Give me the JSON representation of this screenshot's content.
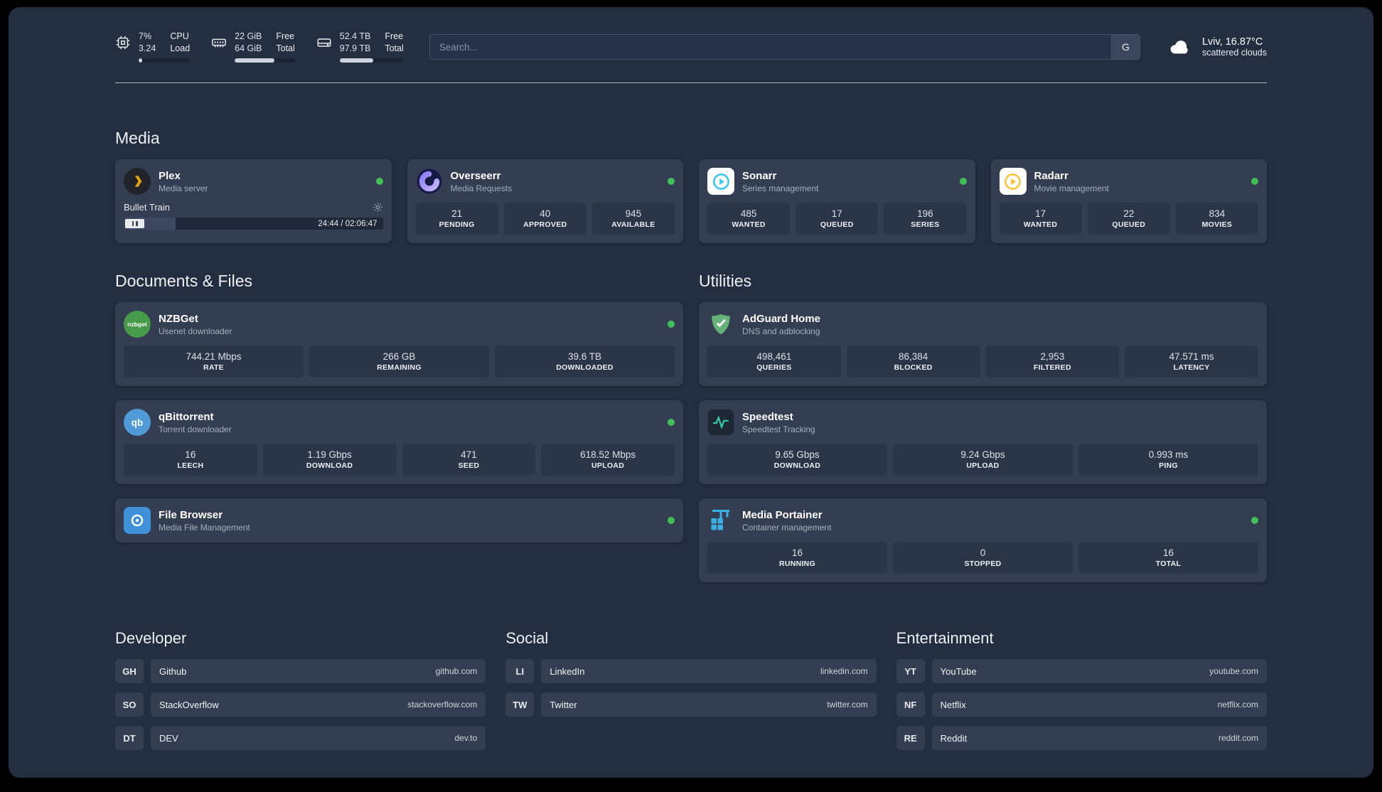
{
  "colors": {
    "status_online": "#40c057",
    "plex": "#e5a00d",
    "overseerr": "#a78bfa",
    "sonarr": "#35c5f4",
    "radarr": "#ffc230",
    "nzbget": "#479a4a",
    "qbittorrent": "#4f9bd8",
    "filebrowser": "#3f8fd9",
    "adguard": "#67b279",
    "speedtest": "#2dd4a8",
    "portainer": "#3bb0e5"
  },
  "topbar": {
    "cpu": {
      "value1": "7%",
      "value2": "3.24",
      "label1": "CPU",
      "label2": "Load",
      "percent": 7
    },
    "ram": {
      "value1": "22 GiB",
      "value2": "64 GiB",
      "label1": "Free",
      "label2": "Total",
      "percent": 66
    },
    "disk": {
      "value1": "52.4 TB",
      "value2": "97.9 TB",
      "label1": "Free",
      "label2": "Total",
      "percent": 53
    },
    "search": {
      "placeholder": "Search...",
      "button_label": "G"
    },
    "weather": {
      "location": "Lviv, 16.87°C",
      "condition": "scattered clouds"
    }
  },
  "sections": {
    "media": "Media",
    "documents": "Documents & Files",
    "utilities": "Utilities",
    "developer": "Developer",
    "social": "Social",
    "entertainment": "Entertainment"
  },
  "apps": {
    "plex": {
      "name": "Plex",
      "desc": "Media server",
      "now_playing": {
        "title": "Bullet Train",
        "time": "24:44 / 02:06:47",
        "progress_percent": 20
      }
    },
    "overseerr": {
      "name": "Overseerr",
      "desc": "Media Requests",
      "stats": [
        {
          "value": "21",
          "label": "PENDING"
        },
        {
          "value": "40",
          "label": "APPROVED"
        },
        {
          "value": "945",
          "label": "AVAILABLE"
        }
      ]
    },
    "sonarr": {
      "name": "Sonarr",
      "desc": "Series management",
      "stats": [
        {
          "value": "485",
          "label": "WANTED"
        },
        {
          "value": "17",
          "label": "QUEUED"
        },
        {
          "value": "196",
          "label": "SERIES"
        }
      ]
    },
    "radarr": {
      "name": "Radarr",
      "desc": "Movie management",
      "stats": [
        {
          "value": "17",
          "label": "WANTED"
        },
        {
          "value": "22",
          "label": "QUEUED"
        },
        {
          "value": "834",
          "label": "MOVIES"
        }
      ]
    },
    "nzbget": {
      "name": "NZBGet",
      "desc": "Usenet downloader",
      "icon_text": "nzbget",
      "stats": [
        {
          "value": "744.21 Mbps",
          "label": "RATE"
        },
        {
          "value": "266 GB",
          "label": "REMAINING"
        },
        {
          "value": "39.6 TB",
          "label": "DOWNLOADED"
        }
      ]
    },
    "qbittorrent": {
      "name": "qBittorrent",
      "desc": "Torrent downloader",
      "icon_text": "qb",
      "stats": [
        {
          "value": "16",
          "label": "LEECH"
        },
        {
          "value": "1.19 Gbps",
          "label": "DOWNLOAD"
        },
        {
          "value": "471",
          "label": "SEED"
        },
        {
          "value": "618.52 Mbps",
          "label": "UPLOAD"
        }
      ]
    },
    "filebrowser": {
      "name": "File Browser",
      "desc": "Media File Management"
    },
    "adguard": {
      "name": "AdGuard Home",
      "desc": "DNS and adblocking",
      "stats": [
        {
          "value": "498,461",
          "label": "QUERIES"
        },
        {
          "value": "86,384",
          "label": "BLOCKED"
        },
        {
          "value": "2,953",
          "label": "FILTERED"
        },
        {
          "value": "47.571 ms",
          "label": "LATENCY"
        }
      ]
    },
    "speedtest": {
      "name": "Speedtest",
      "desc": "Speedtest Tracking",
      "stats": [
        {
          "value": "9.65 Gbps",
          "label": "DOWNLOAD"
        },
        {
          "value": "9.24 Gbps",
          "label": "UPLOAD"
        },
        {
          "value": "0.993 ms",
          "label": "PING"
        }
      ]
    },
    "portainer": {
      "name": "Media Portainer",
      "desc": "Container management",
      "stats": [
        {
          "value": "16",
          "label": "RUNNING"
        },
        {
          "value": "0",
          "label": "STOPPED"
        },
        {
          "value": "16",
          "label": "TOTAL"
        }
      ]
    }
  },
  "links": {
    "developer": [
      {
        "abbr": "GH",
        "name": "Github",
        "url": "github.com"
      },
      {
        "abbr": "SO",
        "name": "StackOverflow",
        "url": "stackoverflow.com"
      },
      {
        "abbr": "DT",
        "name": "DEV",
        "url": "dev.to"
      }
    ],
    "social": [
      {
        "abbr": "LI",
        "name": "LinkedIn",
        "url": "linkedin.com"
      },
      {
        "abbr": "TW",
        "name": "Twitter",
        "url": "twitter.com"
      }
    ],
    "entertainment": [
      {
        "abbr": "YT",
        "name": "YouTube",
        "url": "youtube.com"
      },
      {
        "abbr": "NF",
        "name": "Netflix",
        "url": "netflix.com"
      },
      {
        "abbr": "RE",
        "name": "Reddit",
        "url": "reddit.com"
      }
    ]
  }
}
